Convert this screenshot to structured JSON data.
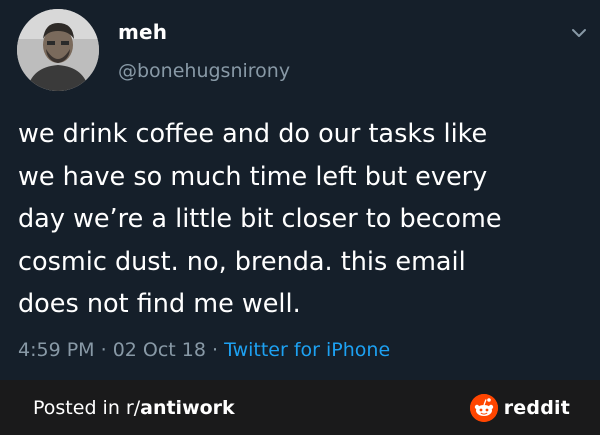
{
  "tweet": {
    "display_name": "meh",
    "handle": "@bonehugsnirony",
    "text_lines": [
      "we drink coffee and do our tasks like",
      "we have so much time left but every",
      "day we’re a little bit closer to become",
      "cosmic dust. no, brenda. this email",
      "does not find me well."
    ],
    "time": "4:59 PM",
    "separator": " · ",
    "date": "02 Oct 18",
    "source": "Twitter for iPhone"
  },
  "footer": {
    "prefix": "Posted in r/",
    "subreddit": "antiwork",
    "brand": "reddit"
  },
  "icons": {
    "avatar": "user-photo",
    "chevron": "chevron-down-icon",
    "logo": "reddit-alien-icon"
  },
  "colors": {
    "background": "#151f2a",
    "footer": "#1a1a1b",
    "secondary_text": "#8899a6",
    "link": "#1da1f2",
    "reddit_orange": "#ff4500"
  }
}
